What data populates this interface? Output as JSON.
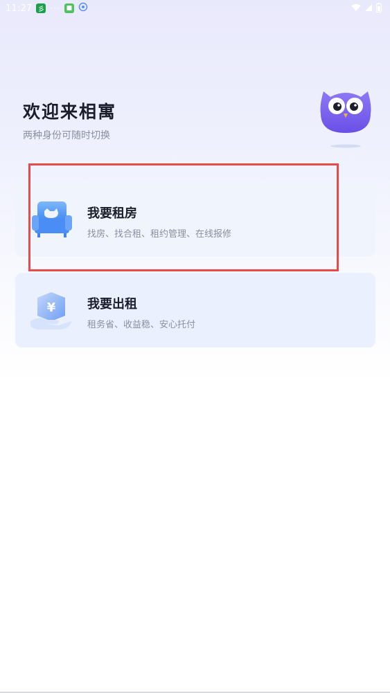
{
  "status_bar": {
    "time": "11:27",
    "notif_icons": [
      "app-icon-green",
      "more-dots-icon",
      "app-icon-lime",
      "vpn-icon"
    ],
    "more_dots": "···",
    "right_icons": [
      "wifi-icon",
      "signal-icon",
      "battery-icon"
    ]
  },
  "header": {
    "title": "欢迎来相寓",
    "subtitle": "两种身份可随时切换"
  },
  "options": [
    {
      "title": "我要租房",
      "desc": "找房、找合租、租约管理、在线报修",
      "icon": "sofa-icon"
    },
    {
      "title": "我要出租",
      "desc": "租务省、收益稳、安心托付",
      "icon": "yuan-hand-icon"
    }
  ],
  "colors": {
    "accent": "#4a8ef5",
    "highlight": "#e84a4a",
    "mascot": "#7f66f0"
  }
}
